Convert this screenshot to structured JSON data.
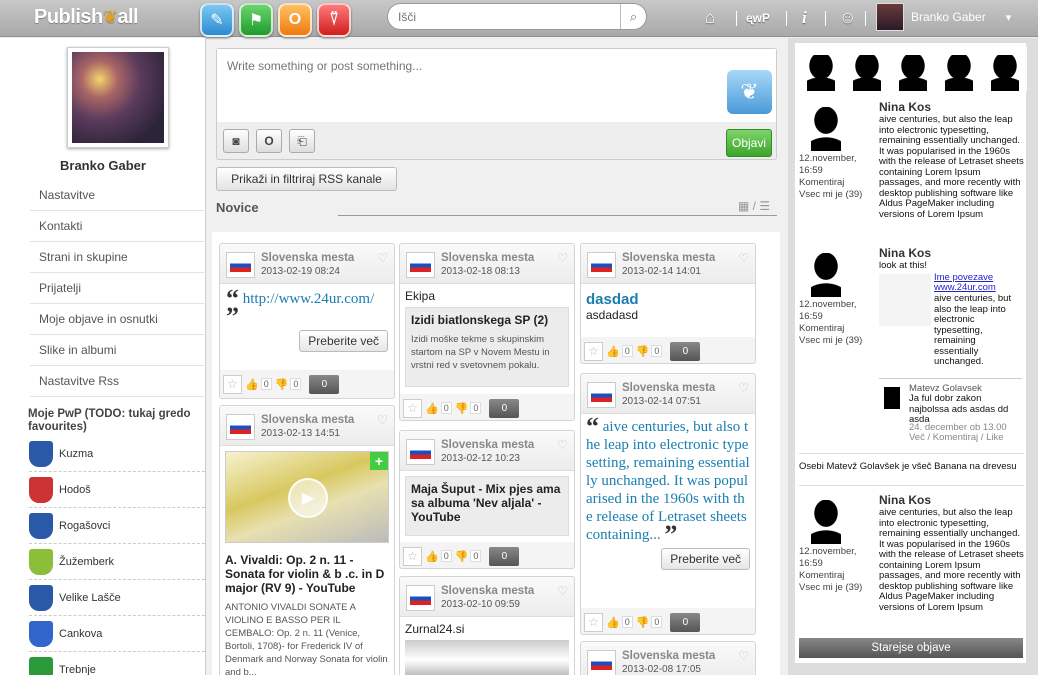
{
  "app": {
    "logo_left": "Publish",
    "logo_fly": "❦",
    "logo_right": "all"
  },
  "top": {
    "apps": [
      "✎",
      "⚑",
      "O",
      "⍢"
    ],
    "search_placeholder": "Išči",
    "search_icon": "⌕",
    "home": "⌂",
    "pwp": "ᶒwP",
    "info": "i",
    "user": "☺",
    "username": "Branko Gaber",
    "caret": "▾"
  },
  "profile": {
    "name": "Branko Gaber"
  },
  "nav": [
    "Nastavitve",
    "Kontakti",
    "Strani in skupine",
    "Prijatelji",
    "Moje objave in osnutki",
    "Slike in albumi",
    "Nastavitve Rss"
  ],
  "favourites": {
    "title": "Moje PwP (TODO: tukaj gredo favourites)",
    "items": [
      {
        "name": "Kuzma",
        "color": "#2a59a8"
      },
      {
        "name": "Hodoš",
        "color": "#c33"
      },
      {
        "name": "Rogašovci",
        "color": "#2a59a8"
      },
      {
        "name": "Žužemberk",
        "color": "#8bbf3a"
      },
      {
        "name": "Velike Lašče",
        "color": "#2a59a8"
      },
      {
        "name": "Cankova",
        "color": "#3366cc"
      },
      {
        "name": "Trebnje",
        "color": "#2a9a3a"
      }
    ]
  },
  "composer": {
    "placeholder": "Write something or post something...",
    "icons": [
      "◙",
      "O",
      "⎗"
    ],
    "fly": "❦",
    "submit": "Objavi"
  },
  "rss_button": "Prikaži in filtriraj RSS kanale",
  "section_title": "Novice",
  "view_icons": "▦ / ☰",
  "card_common": {
    "source": "Slovenska mesta",
    "fly": "♡",
    "star": "☆",
    "up": "👍",
    "down": "👎",
    "zero": "0",
    "more": "Preberite več"
  },
  "cards": [
    {
      "date": "2013-02-19 08:24",
      "quote": "http://www.24ur.com/"
    },
    {
      "date": "2013-02-13 14:51",
      "title": "A. Vivaldi: Op. 2 n. 11 - Sonata for violin & b .c. in D major (RV 9) - YouTube",
      "desc": "ANTONIO VIVALDI SONATE A VIOLINO E BASSO PER IL CEMBALO: Op. 2 n. 11 (Venice, Bortoli, 1708)- for Frederick IV of Denmark and Norway Sonata for violin and b..."
    },
    {
      "date": "2013-02-18 08:13",
      "label": "Ekipa",
      "title": "Izidi biatlonskega SP (2)",
      "desc": "Izidi moške tekme s skupinskim startom na SP v Novem Mestu in vrstni red v svetovnem pokalu."
    },
    {
      "date": "2013-02-12 10:23",
      "title": "Maja Šuput - Mix pjes ama sa albuma 'Nev aljala' - YouTube"
    },
    {
      "date": "2013-02-10 09:59",
      "label": "Zurnal24.si"
    },
    {
      "date": "2013-02-14 14:01",
      "head": "dasdad",
      "sub": "asdadasd"
    },
    {
      "date": "2013-02-14 07:51",
      "quote": "aive centuries, but also the leap into electronic typesetting, remaining essentially unchanged. It was popularised in the 1960s with the release of Letraset sheets containing..."
    },
    {
      "date": "2013-02-08 17:05"
    }
  ],
  "right": {
    "p1": {
      "time": "12.november, 16:59",
      "comment": "Komentiraj",
      "likes": "Vsec mi je (39)",
      "name": "Nina Kos",
      "text": "aive centuries, but also the leap into electronic typesetting, remaining essentially unchanged. It was popularised in the 1960s with the release of Letraset sheets containing Lorem Ipsum passages, and more recently with desktop publishing software like Aldus PageMaker including versions of Lorem Ipsum"
    },
    "p2": {
      "time": "12.november, 16:59",
      "comment": "Komentiraj",
      "likes": "Vsec mi je (39)",
      "name": "Nina Kos",
      "intro": "look at this!",
      "link_title": "Ime povezave",
      "link_url": "www.24ur.com",
      "text": "aive centuries, but also the leap into electronic typesetting, remaining essentially unchanged."
    },
    "c1": {
      "name": "Matevz Golavsek",
      "text": "Ja ful dobr zakon najbolssa ads asdas dd asda",
      "meta": "24. december ob 13.00",
      "actions": "Več / Komentiraj / Like"
    },
    "notice": "Osebi Matevž Golavšek je všeč Banana na drevesu",
    "p3": {
      "time": "12.november, 16:59",
      "comment": "Komentiraj",
      "likes": "Vsec mi je (39)",
      "name": "Nina Kos",
      "text": "aive centuries, but also the leap into electronic typesetting, remaining essentially unchanged. It was popularised in the 1960s with the release of Letraset sheets containing Lorem Ipsum passages, and more recently with desktop publishing software like Aldus PageMaker including versions of Lorem Ipsum"
    },
    "older": "Starejse objave"
  }
}
